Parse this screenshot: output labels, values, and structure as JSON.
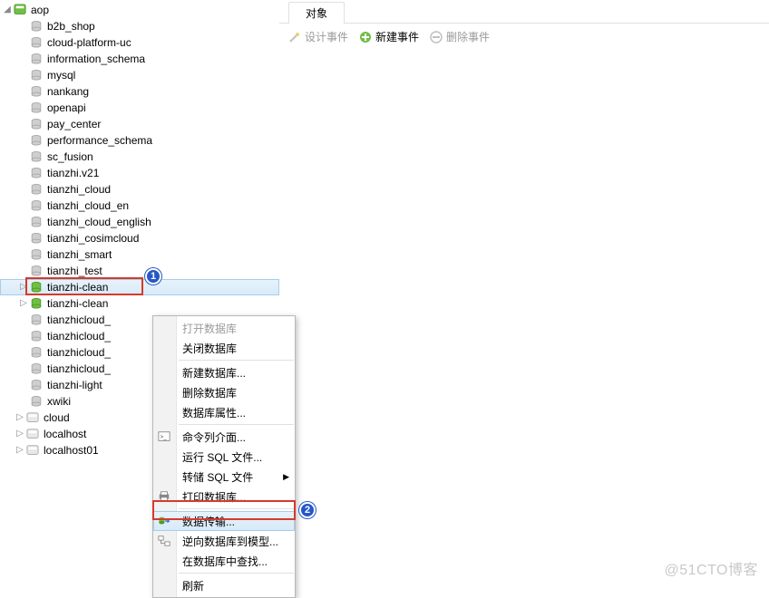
{
  "connection": {
    "name": "aop"
  },
  "sidebar": {
    "databases": [
      {
        "label": "b2b_shop",
        "open": false
      },
      {
        "label": "cloud-platform-uc",
        "open": false
      },
      {
        "label": "information_schema",
        "open": false
      },
      {
        "label": "mysql",
        "open": false
      },
      {
        "label": "nankang",
        "open": false
      },
      {
        "label": "openapi",
        "open": false
      },
      {
        "label": "pay_center",
        "open": false
      },
      {
        "label": "performance_schema",
        "open": false
      },
      {
        "label": "sc_fusion",
        "open": false
      },
      {
        "label": "tianzhi.v21",
        "open": false
      },
      {
        "label": "tianzhi_cloud",
        "open": false
      },
      {
        "label": "tianzhi_cloud_en",
        "open": false
      },
      {
        "label": "tianzhi_cloud_english",
        "open": false
      },
      {
        "label": "tianzhi_cosimcloud",
        "open": false
      },
      {
        "label": "tianzhi_smart",
        "open": false
      },
      {
        "label": "tianzhi_test",
        "open": false
      },
      {
        "label": "tianzhi-clean",
        "open": true,
        "selected": true,
        "expandable": true
      },
      {
        "label": "tianzhi-clean",
        "open": true,
        "expandable": true,
        "clipped": true,
        "shown": "tianzhi-clean"
      },
      {
        "label": "tianzhicloud_",
        "open": false,
        "clipped": true
      },
      {
        "label": "tianzhicloud_",
        "open": false,
        "clipped": true
      },
      {
        "label": "tianzhicloud_",
        "open": false,
        "clipped": true
      },
      {
        "label": "tianzhicloud_",
        "open": false,
        "clipped": true
      },
      {
        "label": "tianzhi-light",
        "open": false
      },
      {
        "label": "xwiki",
        "open": false
      }
    ],
    "connections": [
      {
        "label": "cloud"
      },
      {
        "label": "localhost"
      },
      {
        "label": "localhost01"
      }
    ]
  },
  "main": {
    "tab": "对象",
    "toolbar": {
      "design": "设计事件",
      "new": "新建事件",
      "delete": "删除事件"
    }
  },
  "context_menu": {
    "open_db": "打开数据库",
    "close_db": "关闭数据库",
    "new_db": "新建数据库...",
    "drop_db": "删除数据库",
    "db_props": "数据库属性...",
    "cmd_iface": "命令列介面...",
    "run_sql": "运行 SQL 文件...",
    "dump_sql": "转储 SQL 文件",
    "print_db": "打印数据库...",
    "data_transfer": "数据传输...",
    "reverse_model": "逆向数据库到模型...",
    "find_in_db": "在数据库中查找...",
    "refresh": "刷新"
  },
  "annotations": {
    "badge1": "1",
    "badge2": "2"
  },
  "watermark": "@51CTO博客"
}
